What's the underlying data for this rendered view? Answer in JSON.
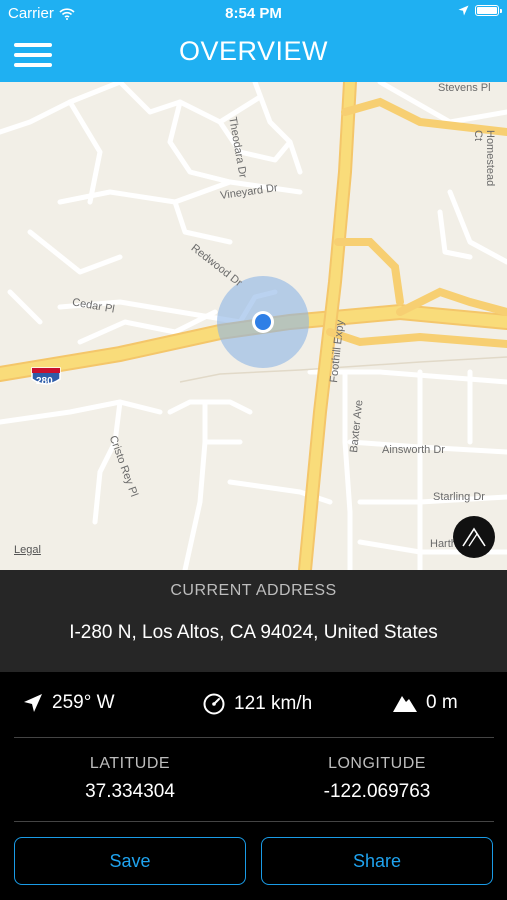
{
  "status_bar": {
    "carrier": "Carrier",
    "time": "8:54 PM"
  },
  "nav": {
    "title": "OVERVIEW"
  },
  "map": {
    "highway_shield": "280",
    "labels": {
      "theodara": "Theodara Dr",
      "stevens": "Stevens Pl",
      "homestead": "Homestead Ct",
      "vineyard": "Vineyard Dr",
      "redwood": "Redwood Dr",
      "cedar": "Cedar Pl",
      "foothill": "Foothill Expy",
      "baxter": "Baxter Ave",
      "ainsworth": "Ainsworth Dr",
      "cristo": "Cristo Rey Pl",
      "starling": "Starling Dr",
      "harth": "Harth"
    },
    "legal": "Legal"
  },
  "address": {
    "label": "CURRENT ADDRESS",
    "value": "I-280 N, Los Altos, CA  94024, United States"
  },
  "metrics": {
    "heading": "259° W",
    "speed": "121 km/h",
    "altitude": "0 m"
  },
  "coords": {
    "lat_label": "LATITUDE",
    "lat_value": "37.334304",
    "lon_label": "LONGITUDE",
    "lon_value": "-122.069763"
  },
  "actions": {
    "save": "Save",
    "share": "Share"
  },
  "colors": {
    "accent": "#1fb0f2",
    "button": "#1a9be6"
  }
}
